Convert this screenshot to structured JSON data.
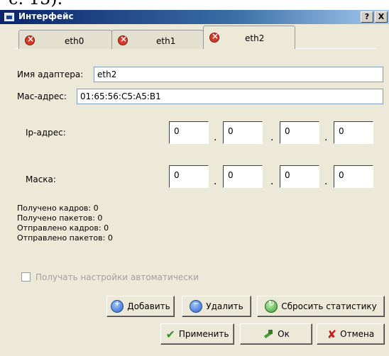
{
  "window": {
    "title": "Интерфейс",
    "help_label": "?",
    "close_label": "X",
    "top_fragment": "c. 15)."
  },
  "tabs": [
    {
      "label": "eth0",
      "active": false
    },
    {
      "label": "eth1",
      "active": false
    },
    {
      "label": "eth2",
      "active": true
    }
  ],
  "adapter": {
    "label": "Имя адаптера:",
    "value": "eth2"
  },
  "mac": {
    "label": "Mac-адрес:",
    "value": "01:65:56:C5:A5:B1"
  },
  "ip": {
    "label": "Ip-адрес:",
    "octets": [
      "0",
      "0",
      "0",
      "0"
    ]
  },
  "mask": {
    "label": "Маска:",
    "octets": [
      "0",
      "0",
      "0",
      "0"
    ]
  },
  "dot": ".",
  "stats": {
    "frames_received": "Получено кадров: 0",
    "packets_received": "Получено пакетов: 0",
    "frames_sent": "Отправлено кадров: 0",
    "packets_sent": "Отправлено пакетов: 0"
  },
  "auto_settings": {
    "label": "Получать настройки автоматически",
    "checked": false,
    "enabled": false
  },
  "buttons": {
    "add": "Добавить",
    "remove": "Удалить",
    "reset_stats": "Сбросить статистику",
    "apply": "Применить",
    "ok": "Ок",
    "cancel": "Отмена"
  },
  "icons": {
    "window": "network-window-icon",
    "tab": "error-x-icon",
    "add": "add-icon",
    "remove": "remove-icon",
    "reset": "reset-icon",
    "apply": "checkmark-icon",
    "ok": "ok-hammer-icon",
    "cancel": "cancel-x-icon"
  },
  "colors": {
    "titlebar": "#0a246a",
    "window_bg": "#ece9d8",
    "tab_error": "#d83a2a",
    "disabled_text": "#a0a0a0"
  }
}
